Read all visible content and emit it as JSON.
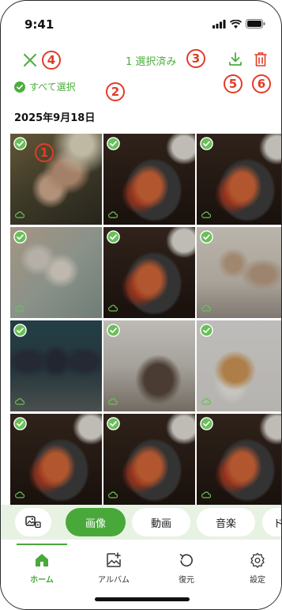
{
  "status": {
    "time": "9:41"
  },
  "header": {
    "selected_count": "1 選択済み",
    "select_all_label": "すべて選択"
  },
  "date_label": "2025年9月18日",
  "callouts": [
    "1",
    "2",
    "3",
    "4",
    "5",
    "6"
  ],
  "photos": [
    {
      "kind": "p-hug",
      "icon": "family-hug-photo"
    },
    {
      "kind": "p-food",
      "icon": "food-photo"
    },
    {
      "kind": "p-food",
      "icon": "food-photo"
    },
    {
      "kind": "p-kids",
      "icon": "kitchen-photo"
    },
    {
      "kind": "p-food",
      "icon": "food-photo"
    },
    {
      "kind": "p-women",
      "icon": "tea-photo"
    },
    {
      "kind": "p-school",
      "icon": "schoolkids-photo"
    },
    {
      "kind": "p-room",
      "icon": "room-photo"
    },
    {
      "kind": "p-dog",
      "icon": "shiba-dog-photo"
    },
    {
      "kind": "p-food",
      "icon": "food-photo"
    },
    {
      "kind": "p-food",
      "icon": "food-photo"
    },
    {
      "kind": "p-food",
      "icon": "food-photo"
    }
  ],
  "chips": [
    "画像",
    "動画",
    "音楽",
    "ド"
  ],
  "tabs": [
    "ホーム",
    "アルバム",
    "復元",
    "設定"
  ],
  "colors": {
    "accent": "#48a93a",
    "callout": "#e23c28"
  }
}
